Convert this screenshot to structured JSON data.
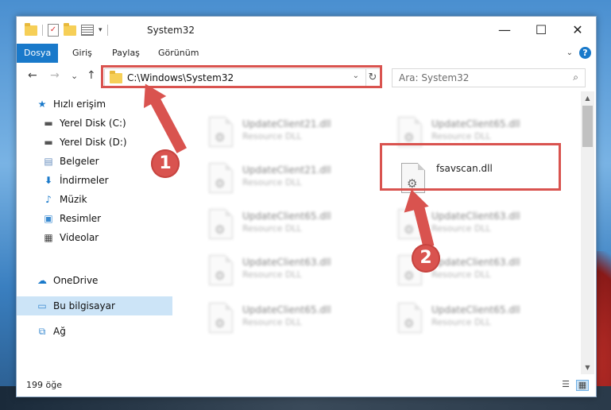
{
  "window": {
    "title": "System32",
    "minimize": "—",
    "maximize": "☐",
    "close": "✕"
  },
  "ribbon": {
    "tabs": [
      "Dosya",
      "Giriş",
      "Paylaş",
      "Görünüm"
    ],
    "collapse": "⌄",
    "help": "?"
  },
  "nav": {
    "back": "←",
    "forward": "→",
    "recent": "⌄",
    "up": "↑",
    "address": "C:\\Windows\\System32",
    "address_dropdown": "⌄",
    "refresh": "↻",
    "search_placeholder": "Ara: System32",
    "search_icon": "⌕"
  },
  "sidebar": {
    "items": [
      {
        "label": "Hızlı erişim",
        "icon": "star-icon",
        "pinned": false
      },
      {
        "label": "Yerel Disk (C:)",
        "icon": "drive-icon",
        "pinned": true
      },
      {
        "label": "Yerel Disk (D:)",
        "icon": "drive-icon",
        "pinned": true
      },
      {
        "label": "Belgeler",
        "icon": "document-icon",
        "pinned": true
      },
      {
        "label": "İndirmeler",
        "icon": "download-icon",
        "pinned": true
      },
      {
        "label": "Müzik",
        "icon": "music-icon",
        "pinned": true
      },
      {
        "label": "Resimler",
        "icon": "pictures-icon",
        "pinned": true
      },
      {
        "label": "Videolar",
        "icon": "video-icon",
        "pinned": true
      },
      {
        "label": "OneDrive",
        "icon": "cloud-icon",
        "pinned": false
      },
      {
        "label": "Bu bilgisayar",
        "icon": "computer-icon",
        "pinned": false
      },
      {
        "label": "Ağ",
        "icon": "network-icon",
        "pinned": false
      }
    ],
    "pin_glyph": "📌"
  },
  "files": [
    {
      "name": "UpdateClient21.dll",
      "type": "Resource DLL"
    },
    {
      "name": "UpdateClient65.dll",
      "type": "Resource DLL"
    },
    {
      "name": "UpdateClient21.dll",
      "type": "Resource DLL"
    },
    {
      "name": "fsavscan.dll",
      "type": ""
    },
    {
      "name": "UpdateClient65.dll",
      "type": "Resource DLL"
    },
    {
      "name": "UpdateClient63.dll",
      "type": "Resource DLL"
    },
    {
      "name": "UpdateClient63.dll",
      "type": "Resource DLL"
    },
    {
      "name": "UpdateClient63.dll",
      "type": "Resource DLL"
    },
    {
      "name": "UpdateClient65.dll",
      "type": "Resource DLL"
    },
    {
      "name": "UpdateClient65.dll",
      "type": "Resource DLL"
    }
  ],
  "status": {
    "count": "199 öğe"
  },
  "annotations": {
    "step1": "1",
    "step2": "2",
    "color": "#d9534f"
  }
}
